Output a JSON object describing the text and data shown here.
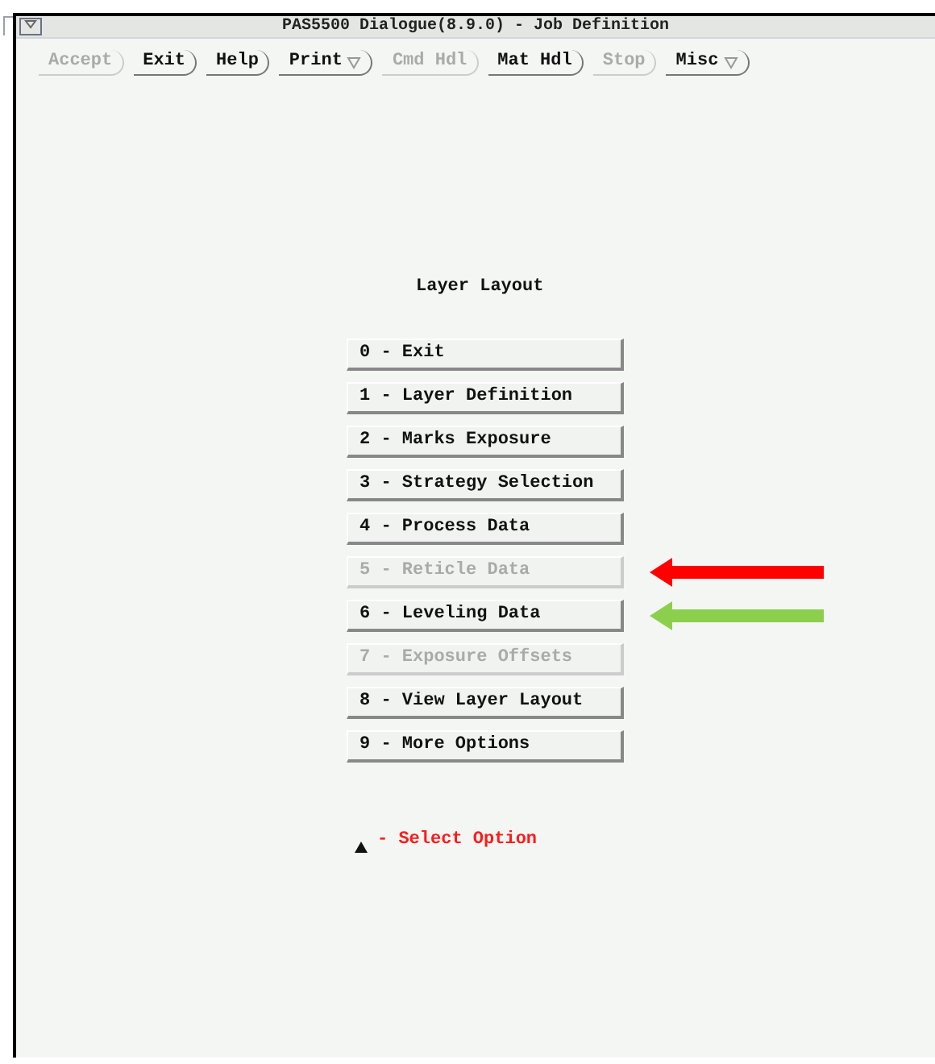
{
  "window": {
    "title": "PAS5500 Dialogue(8.9.0) - Job Definition"
  },
  "toolbar": [
    {
      "label": "Accept",
      "disabled": true,
      "menu": false
    },
    {
      "label": "Exit",
      "disabled": false,
      "menu": false
    },
    {
      "label": "Help",
      "disabled": false,
      "menu": false
    },
    {
      "label": "Print",
      "disabled": false,
      "menu": true
    },
    {
      "label": "Cmd Hdl",
      "disabled": true,
      "menu": false
    },
    {
      "label": "Mat Hdl",
      "disabled": false,
      "menu": false
    },
    {
      "label": "Stop",
      "disabled": true,
      "menu": false
    },
    {
      "label": "Misc",
      "disabled": false,
      "menu": true
    }
  ],
  "heading": "Layer Layout",
  "menu_items": [
    {
      "label": "0 - Exit",
      "disabled": false
    },
    {
      "label": "1 - Layer Definition",
      "disabled": false
    },
    {
      "label": "2 - Marks Exposure",
      "disabled": false
    },
    {
      "label": "3 - Strategy Selection",
      "disabled": false
    },
    {
      "label": "4 - Process Data",
      "disabled": false
    },
    {
      "label": "5 - Reticle Data",
      "disabled": true,
      "arrow": {
        "color": "#ff0000"
      }
    },
    {
      "label": "6 - Leveling Data",
      "disabled": false,
      "arrow": {
        "color": "#8ccf4d"
      }
    },
    {
      "label": "7 - Exposure Offsets",
      "disabled": true
    },
    {
      "label": "8 - View Layer Layout",
      "disabled": false
    },
    {
      "label": "9 - More Options",
      "disabled": false
    }
  ],
  "prompt": "- Select Option"
}
